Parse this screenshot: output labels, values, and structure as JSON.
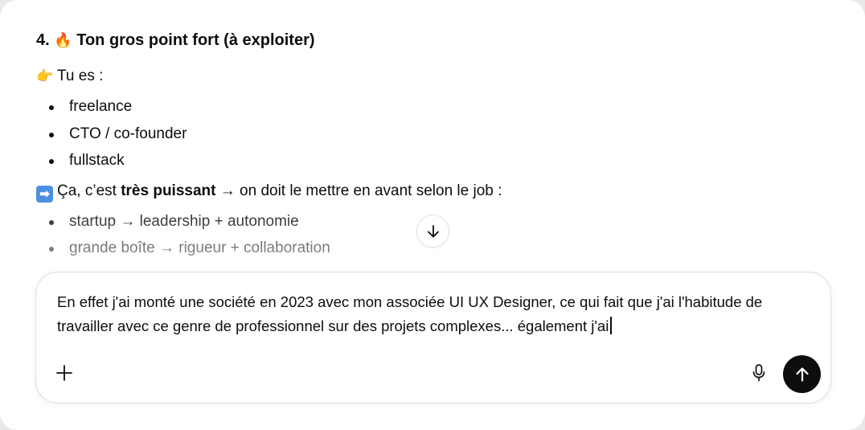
{
  "message": {
    "heading": {
      "number": "4.",
      "emoji": "🔥",
      "text": "Ton gros point fort (à exploiter)"
    },
    "intro": {
      "emoji": "👉",
      "text": "Tu es :"
    },
    "roles": [
      "freelance",
      "CTO / co-founder",
      "fullstack"
    ],
    "conclusion": {
      "emoji": "➡",
      "text_before": "Ça, c’est ",
      "bold": "très puissant",
      "text_after": " → on doit le mettre en avant selon le job :"
    },
    "job_types": [
      "startup → leadership + autonomie",
      "grande boîte → rigueur + collaboration"
    ]
  },
  "scroll_button": {
    "icon": "arrow-down-icon"
  },
  "composer": {
    "text": "En effet j'ai monté une société en 2023 avec mon associée UI UX Designer, ce qui fait que j'ai l'habitude de travailler avec ce genre de professionnel sur des projets complexes... également j'ai",
    "add_icon": "plus-icon",
    "mic_icon": "microphone-icon",
    "send_icon": "arrow-up-icon"
  },
  "colors": {
    "text": "#0d0d0d",
    "send_button": "#0d0d0d",
    "border": "#dcdcdc"
  }
}
